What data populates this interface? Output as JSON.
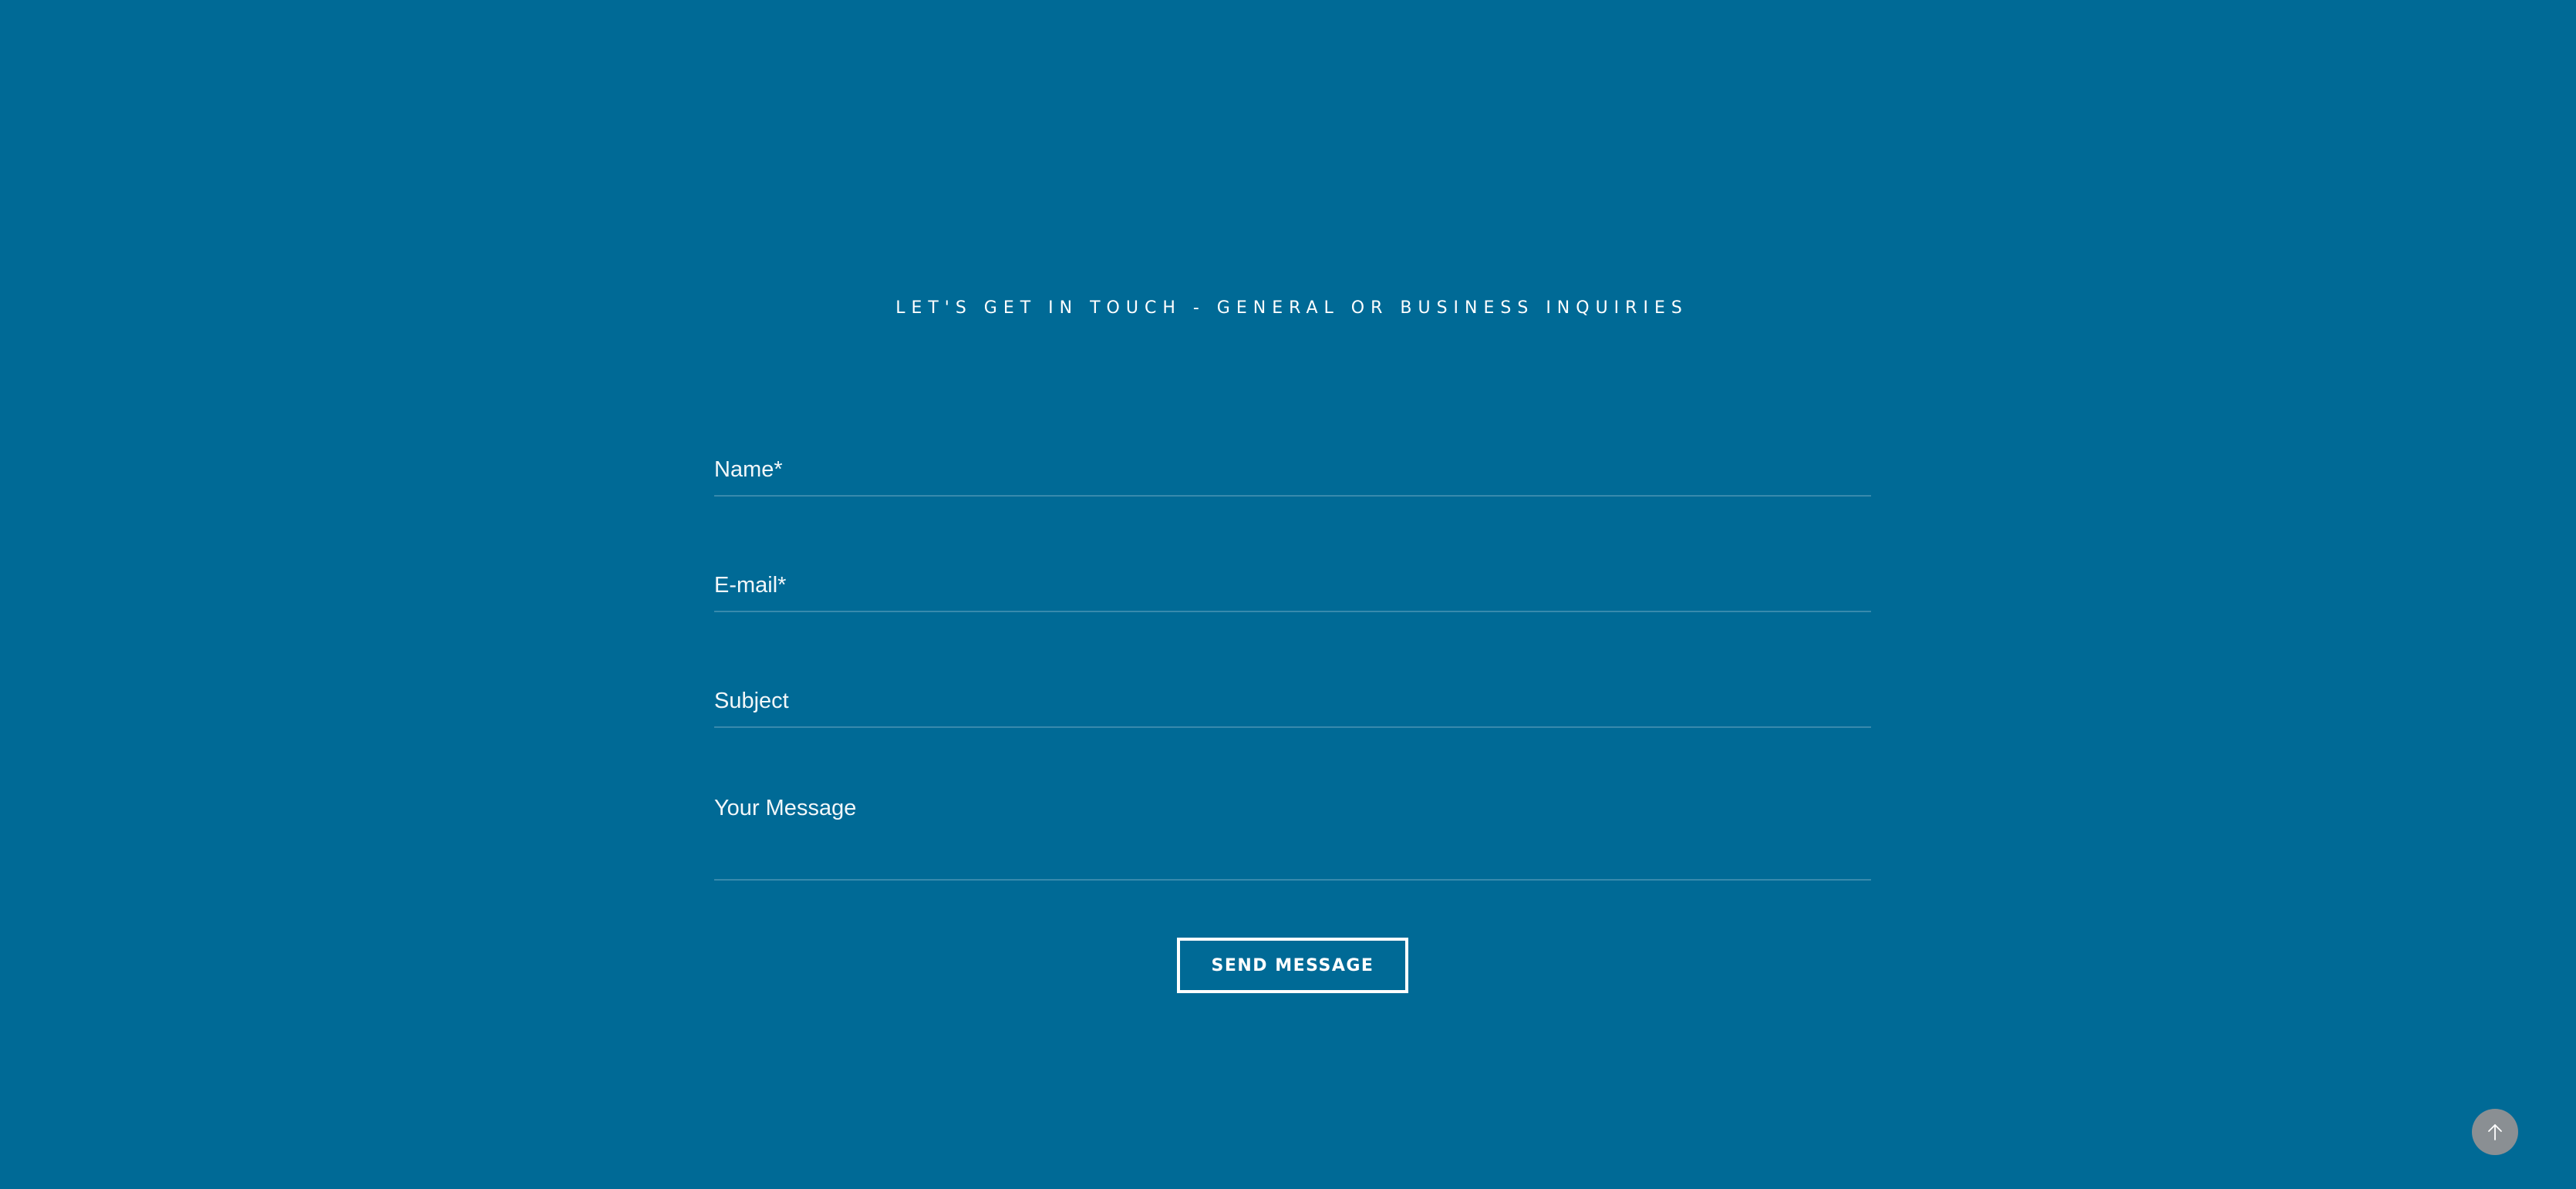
{
  "contact": {
    "heading": "LET'S GET IN TOUCH - GENERAL OR BUSINESS INQUIRIES",
    "fields": {
      "name": {
        "placeholder": "Name*",
        "value": ""
      },
      "email": {
        "placeholder": "E-mail*",
        "value": ""
      },
      "subject": {
        "placeholder": "Subject",
        "value": ""
      },
      "message": {
        "placeholder": "Your Message",
        "value": ""
      }
    },
    "submit_label": "SEND MESSAGE"
  },
  "scroll_top": {
    "icon": "arrow-up-icon"
  },
  "colors": {
    "background": "#006a96",
    "text": "#ffffff",
    "scroll_top_button": "#8a8f93"
  }
}
